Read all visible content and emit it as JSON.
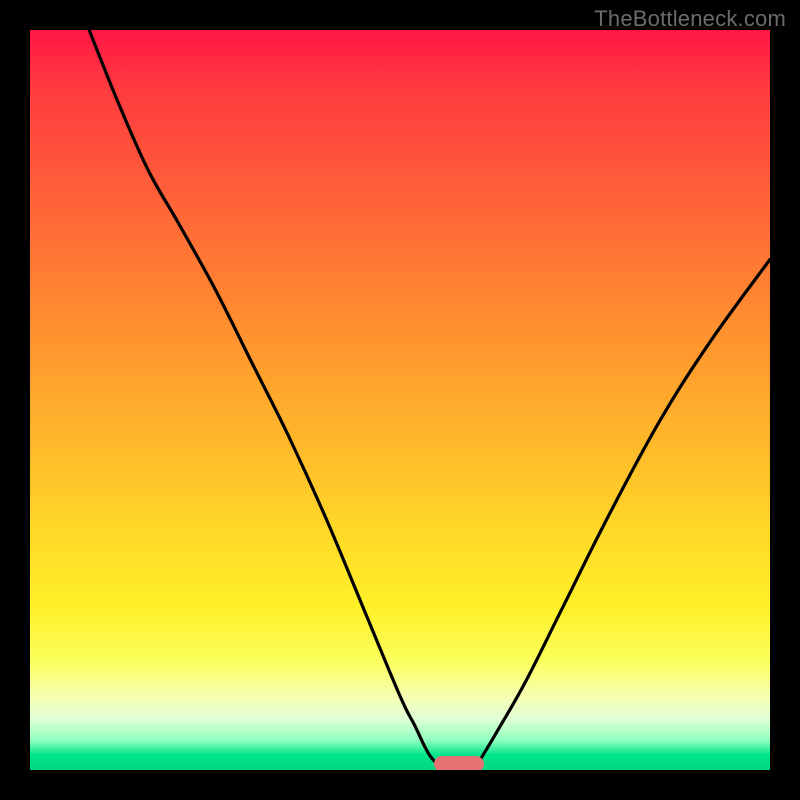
{
  "watermark": "TheBottleneck.com",
  "chart_data": {
    "type": "line",
    "title": "",
    "xlabel": "",
    "ylabel": "",
    "xlim": [
      0,
      100
    ],
    "ylim": [
      0,
      100
    ],
    "grid": false,
    "legend": false,
    "series": [
      {
        "name": "left-curve",
        "x": [
          8,
          12,
          16,
          20,
          25,
          30,
          35,
          40,
          45,
          50,
          52,
          54,
          56
        ],
        "y": [
          100,
          90,
          81,
          74,
          65,
          55,
          45,
          34,
          22,
          10,
          6,
          2,
          0
        ]
      },
      {
        "name": "right-curve",
        "x": [
          60,
          63,
          67,
          72,
          78,
          85,
          92,
          100
        ],
        "y": [
          0,
          5,
          12,
          22,
          34,
          47,
          58,
          69
        ]
      }
    ],
    "annotations": [
      {
        "name": "bottleneck-marker",
        "x": 58,
        "y": 0,
        "shape": "pill",
        "color": "#e57373"
      }
    ],
    "background_gradient": {
      "direction": "vertical",
      "stops": [
        {
          "pos": 0.0,
          "color": "#ff1744"
        },
        {
          "pos": 0.2,
          "color": "#ff5a3a"
        },
        {
          "pos": 0.44,
          "color": "#ff9a2e"
        },
        {
          "pos": 0.68,
          "color": "#ffd927"
        },
        {
          "pos": 0.85,
          "color": "#fbff5a"
        },
        {
          "pos": 0.96,
          "color": "#8fffbf"
        },
        {
          "pos": 1.0,
          "color": "#00d880"
        }
      ]
    }
  }
}
